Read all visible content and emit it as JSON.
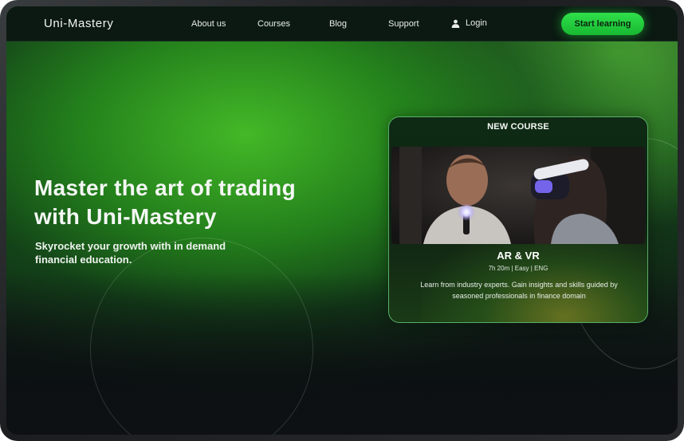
{
  "nav": {
    "logo": "Uni-Mastery",
    "links": [
      "About us",
      "Courses",
      "Blog",
      "Support"
    ],
    "login": "Login",
    "cta": "Start learning"
  },
  "hero": {
    "title_line1": "Master the art of trading",
    "title_line2_prefix": "with",
    "title_line2_brand": "Uni-Mastery",
    "subtitle": "Skyrocket your growth with in demand financial education."
  },
  "card": {
    "badge": "NEW COURSE",
    "title": "AR & VR",
    "meta": "7h 20m | Easy | ENG",
    "description": "Learn from industry experts. Gain insights and skills guided by seasoned professionals in finance domain"
  },
  "colors": {
    "accent": "#1fd33b",
    "nav_bg": "#0b1912",
    "page_dark": "#0d1114"
  },
  "icons": {
    "login": "user-icon"
  }
}
